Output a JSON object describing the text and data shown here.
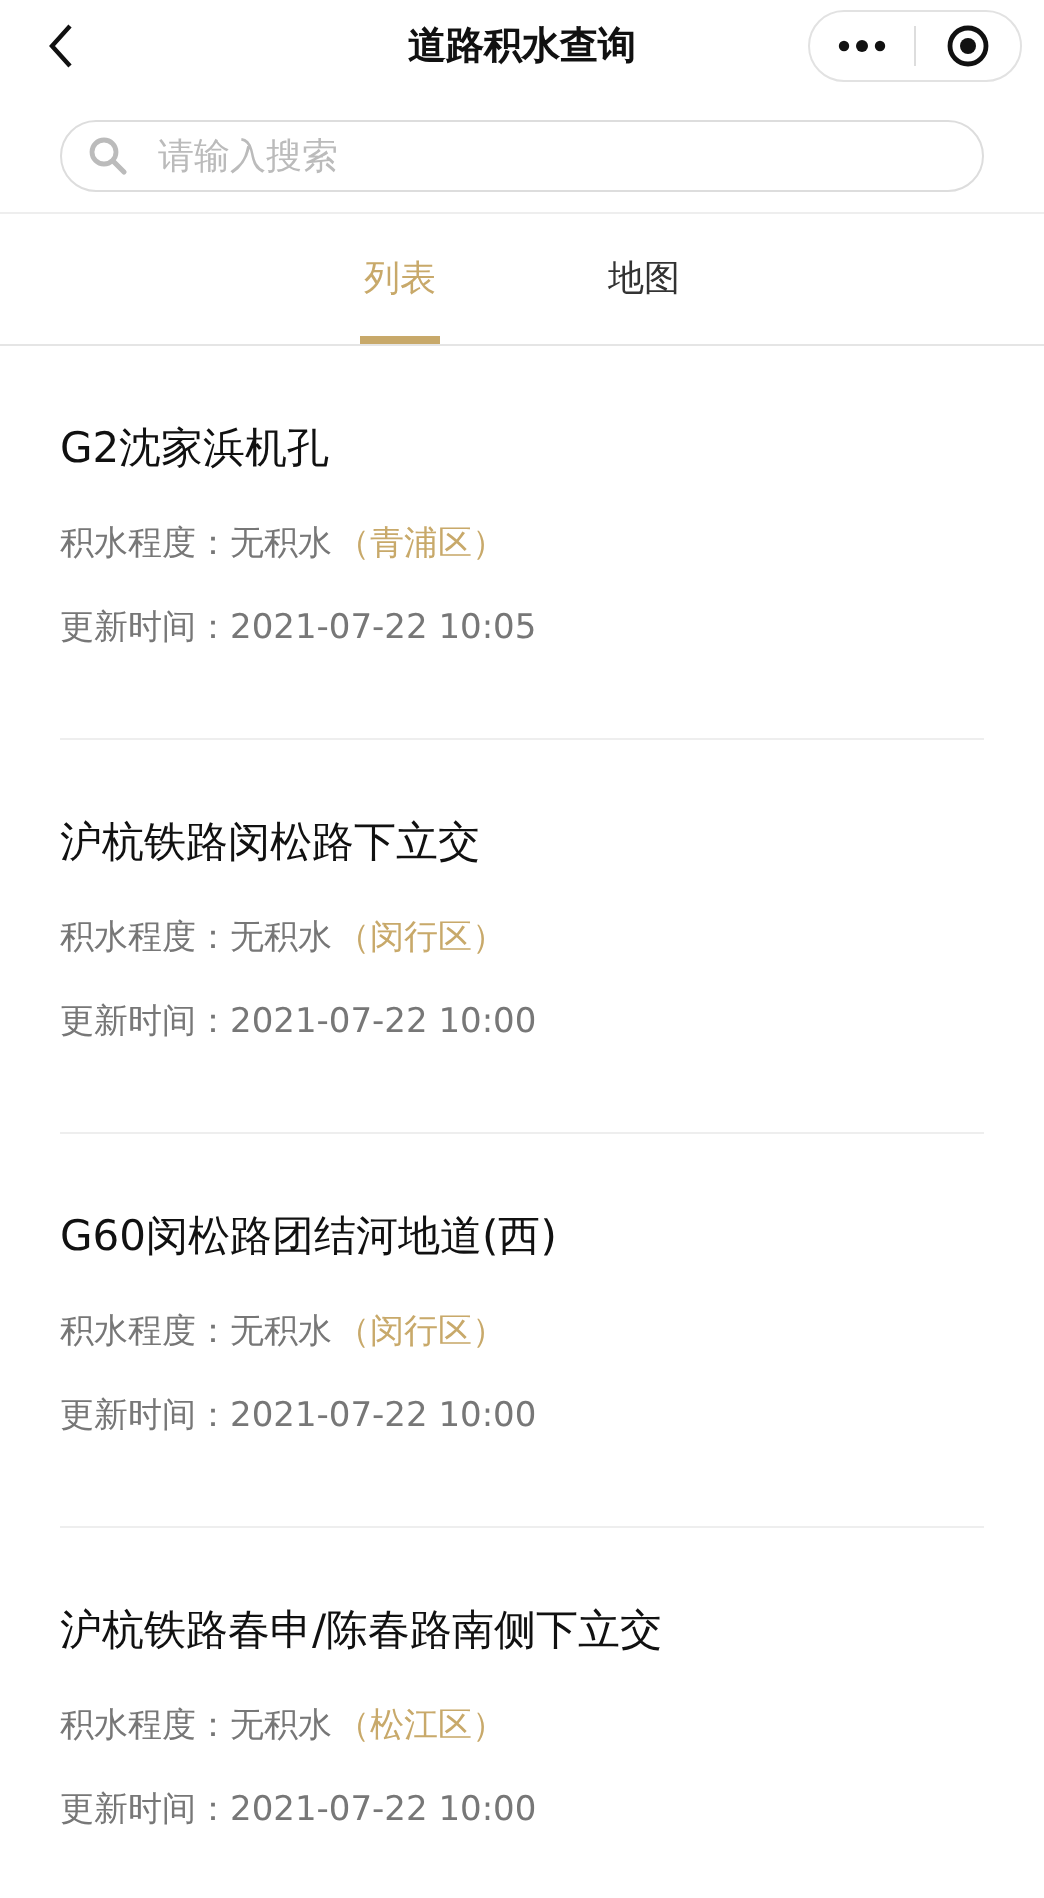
{
  "header": {
    "title": "道路积水查询"
  },
  "search": {
    "placeholder": "请输入搜索"
  },
  "tabs": [
    {
      "label": "列表",
      "selected": true
    },
    {
      "label": "地图",
      "selected": false
    }
  ],
  "items": [
    {
      "name": "G2沈家浜机孔",
      "level_label": "积水程度：",
      "level_value": "无积水",
      "district": "（青浦区）",
      "time_label": "更新时间：",
      "time": "2021-07-22 10:05"
    },
    {
      "name": "沪杭铁路闵松路下立交",
      "level_label": "积水程度：",
      "level_value": "无积水",
      "district": "（闵行区）",
      "time_label": "更新时间：",
      "time": "2021-07-22 10:00"
    },
    {
      "name": "G60闵松路团结河地道(西)",
      "level_label": "积水程度：",
      "level_value": "无积水",
      "district": "（闵行区）",
      "time_label": "更新时间：",
      "time": "2021-07-22 10:00"
    },
    {
      "name": "沪杭铁路春申/陈春路南侧下立交",
      "level_label": "积水程度：",
      "level_value": "无积水",
      "district": "（松江区）",
      "time_label": "更新时间：",
      "time": "2021-07-22 10:00"
    }
  ]
}
